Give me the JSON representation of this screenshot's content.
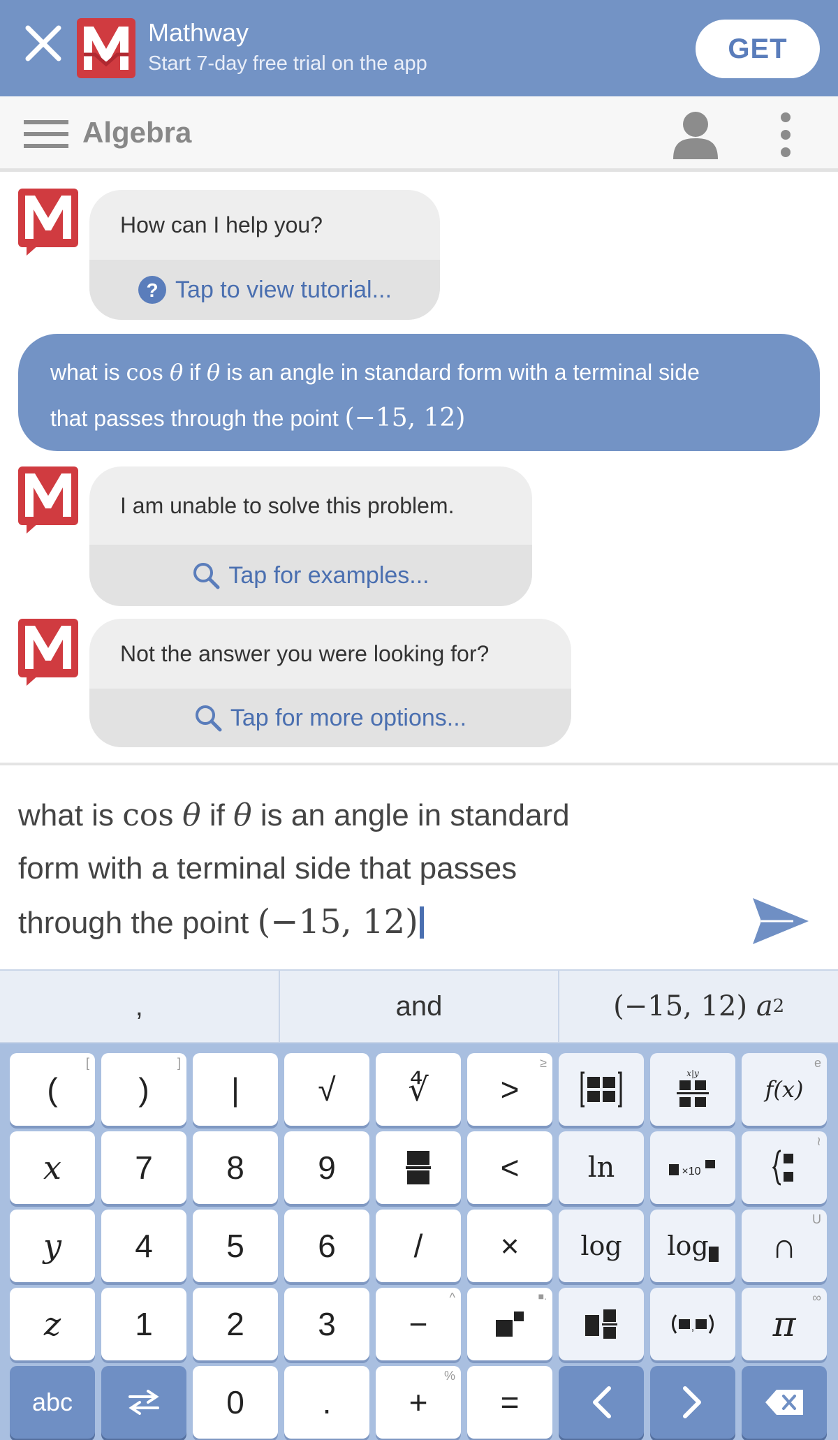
{
  "banner": {
    "app_name": "Mathway",
    "subtitle": "Start 7-day free trial on the app",
    "get_label": "GET",
    "bg_color": "#7393c5"
  },
  "topbar": {
    "subject": "Algebra",
    "icons": [
      "hamburger-menu-icon",
      "user-icon",
      "more-vertical-icon"
    ]
  },
  "chat": {
    "greeting": "How can I help you?",
    "tutorial_link": "Tap to view tutorial...",
    "user_question": {
      "part1": "what is",
      "cos": "cos",
      "theta": "θ",
      "part2": "if",
      "part3": "is an angle in standard form with a terminal side",
      "part4": "that passes through the point",
      "point": "(−15, 12)"
    },
    "unable": "I am unable to solve this problem.",
    "examples_link": "Tap for examples...",
    "not_answer": "Not the answer you were looking for?",
    "more_options_link": "Tap for more options..."
  },
  "input": {
    "line1_a": "what is",
    "cos": "cos",
    "theta": "θ",
    "line1_b": "if",
    "line1_c": "is an angle in standard",
    "line2": "form with a terminal side that passes",
    "line3": "through the point",
    "point": "(−15, 12)"
  },
  "suggestions": {
    "comma": ",",
    "and": "and",
    "point": "(−15, 12)",
    "a_var": "a",
    "a_exp": "2"
  },
  "keyboard": {
    "row1": [
      "(",
      ")",
      "|",
      "√",
      "∜",
      ">",
      "matrix",
      "fraction-matrix",
      "f(x)"
    ],
    "row1_sup": [
      "[",
      "]",
      "",
      "",
      "",
      "≥",
      "",
      "",
      "e"
    ],
    "row2": [
      "x",
      "7",
      "8",
      "9",
      "fraction",
      "<",
      "ln",
      "sci-notation",
      "piecewise"
    ],
    "row3": [
      "y",
      "4",
      "5",
      "6",
      "/",
      "×",
      "log",
      "log-base",
      "∩"
    ],
    "row3_sup": [
      "",
      "",
      "",
      "",
      "",
      "",
      "",
      "",
      "U"
    ],
    "row4": [
      "z",
      "1",
      "2",
      "3",
      "−",
      "power",
      "mixed-number",
      "paren-group",
      "π"
    ],
    "row4_sup": [
      "",
      "",
      "",
      "",
      "^",
      "",
      "",
      "",
      "∞"
    ],
    "row5": [
      "abc",
      "⇆",
      "0",
      ".",
      "+",
      "=",
      "<",
      ">",
      "⌫"
    ],
    "row5_sup": [
      "",
      "",
      "",
      "",
      "%",
      "",
      "",
      "",
      ""
    ],
    "fx_label": "f(x)",
    "ln_label": "ln",
    "log_label": "log",
    "logb_label": "log",
    "x10_label": "×10"
  }
}
